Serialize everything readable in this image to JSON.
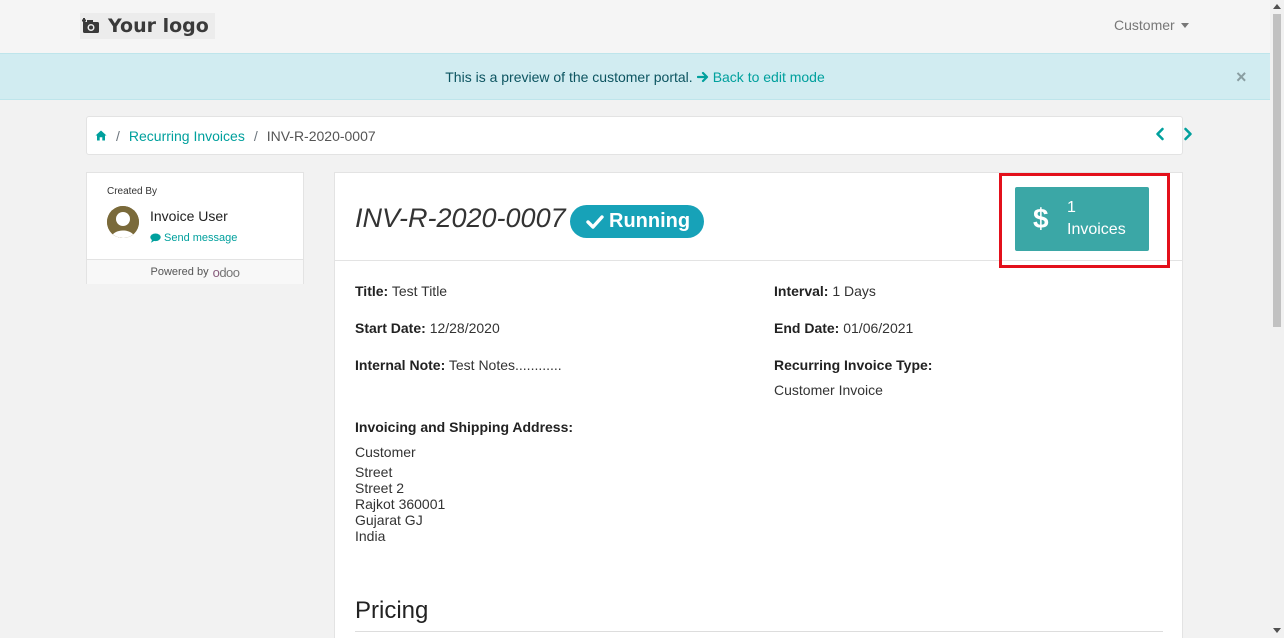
{
  "header": {
    "logo_text": "Your logo",
    "user_menu": "Customer"
  },
  "banner": {
    "text": "This is a preview of the customer portal.",
    "back_link": "Back to edit mode",
    "close": "×"
  },
  "breadcrumb": {
    "parent": "Recurring Invoices",
    "current": "INV-R-2020-0007",
    "sep": "/"
  },
  "sidebar": {
    "created_by_label": "Created By",
    "user_name": "Invoice User",
    "send_message": "Send message",
    "powered_by": "Powered by",
    "brand": "odoo"
  },
  "record": {
    "name": "INV-R-2020-0007",
    "status": "Running",
    "invoice_count": "1",
    "invoice_label": "Invoices",
    "fields": {
      "title_label": "Title:",
      "title_value": "Test Title",
      "interval_label": "Interval:",
      "interval_value": "1 Days",
      "start_label": "Start Date:",
      "start_value": "12/28/2020",
      "end_label": "End Date:",
      "end_value": "01/06/2021",
      "note_label": "Internal Note:",
      "note_value": "Test Notes............",
      "type_label": "Recurring Invoice Type:",
      "type_value": "Customer Invoice",
      "address_label": "Invoicing and Shipping Address:"
    },
    "address": [
      "Customer",
      "Street",
      "Street 2",
      "Rajkot 360001",
      "Gujarat GJ",
      "India"
    ],
    "pricing_heading": "Pricing"
  },
  "colors": {
    "accent": "#00a09d",
    "badge": "#17a2b8",
    "invoice_button": "#3ba7a6",
    "highlight": "#e3101b",
    "banner_bg": "#d1ecf1"
  }
}
